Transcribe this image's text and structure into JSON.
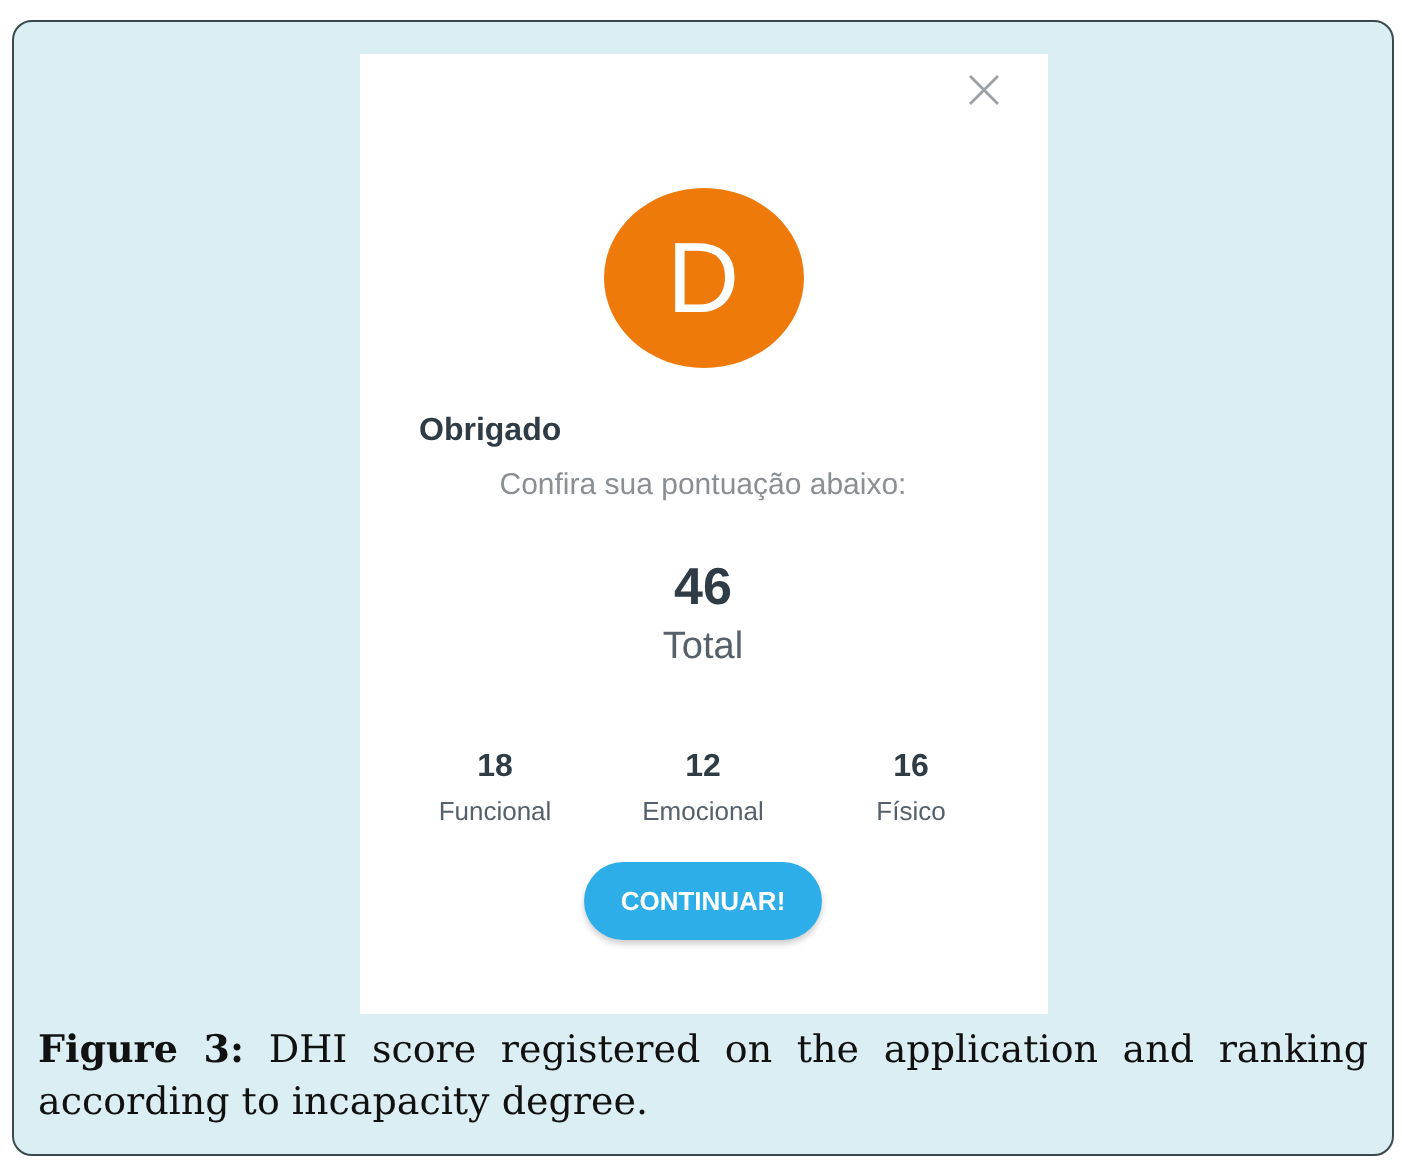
{
  "screen": {
    "avatar_letter": "D",
    "heading": "Obrigado",
    "subtitle": "Confira sua pontuação abaixo:",
    "total": {
      "value": "46",
      "label": "Total"
    },
    "scores": [
      {
        "value": "18",
        "label": "Funcional"
      },
      {
        "value": "12",
        "label": "Emocional"
      },
      {
        "value": "16",
        "label": "Físico"
      }
    ],
    "button": "CONTINUAR!"
  },
  "caption": "**Figure 3:** DHI score registered on the application and ranking according to incapacity degree."
}
